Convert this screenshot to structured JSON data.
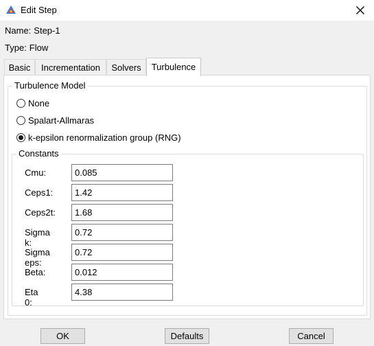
{
  "window": {
    "title": "Edit Step",
    "icon": "abaqus-step-icon",
    "close_icon": "close-icon"
  },
  "info": {
    "name_label": "Name:",
    "name_value": "Step-1",
    "type_label": "Type:",
    "type_value": "Flow"
  },
  "tabs": [
    {
      "label": "Basic",
      "active": false
    },
    {
      "label": "Incrementation",
      "active": false
    },
    {
      "label": "Solvers",
      "active": false
    },
    {
      "label": "Turbulence",
      "active": true
    }
  ],
  "turbulence_model": {
    "title": "Turbulence Model",
    "options": [
      {
        "label": "None",
        "selected": false
      },
      {
        "label": "Spalart-Allmaras",
        "selected": false
      },
      {
        "label": "k-epsilon renormalization group (RNG)",
        "selected": true
      }
    ]
  },
  "constants": {
    "title": "Constants",
    "rows": [
      {
        "label": "Cmu:",
        "value": "0.085"
      },
      {
        "label": "Ceps1:",
        "value": "1.42"
      },
      {
        "label": "Ceps2t:",
        "value": "1.68"
      },
      {
        "label": "Sigma k:",
        "value": "0.72"
      },
      {
        "label": "Sigma eps:",
        "value": "0.72"
      },
      {
        "label": "Beta:",
        "value": "0.012"
      },
      {
        "label": "Eta 0:",
        "value": "4.38"
      }
    ]
  },
  "buttons": {
    "ok": "OK",
    "defaults": "Defaults",
    "cancel": "Cancel"
  }
}
